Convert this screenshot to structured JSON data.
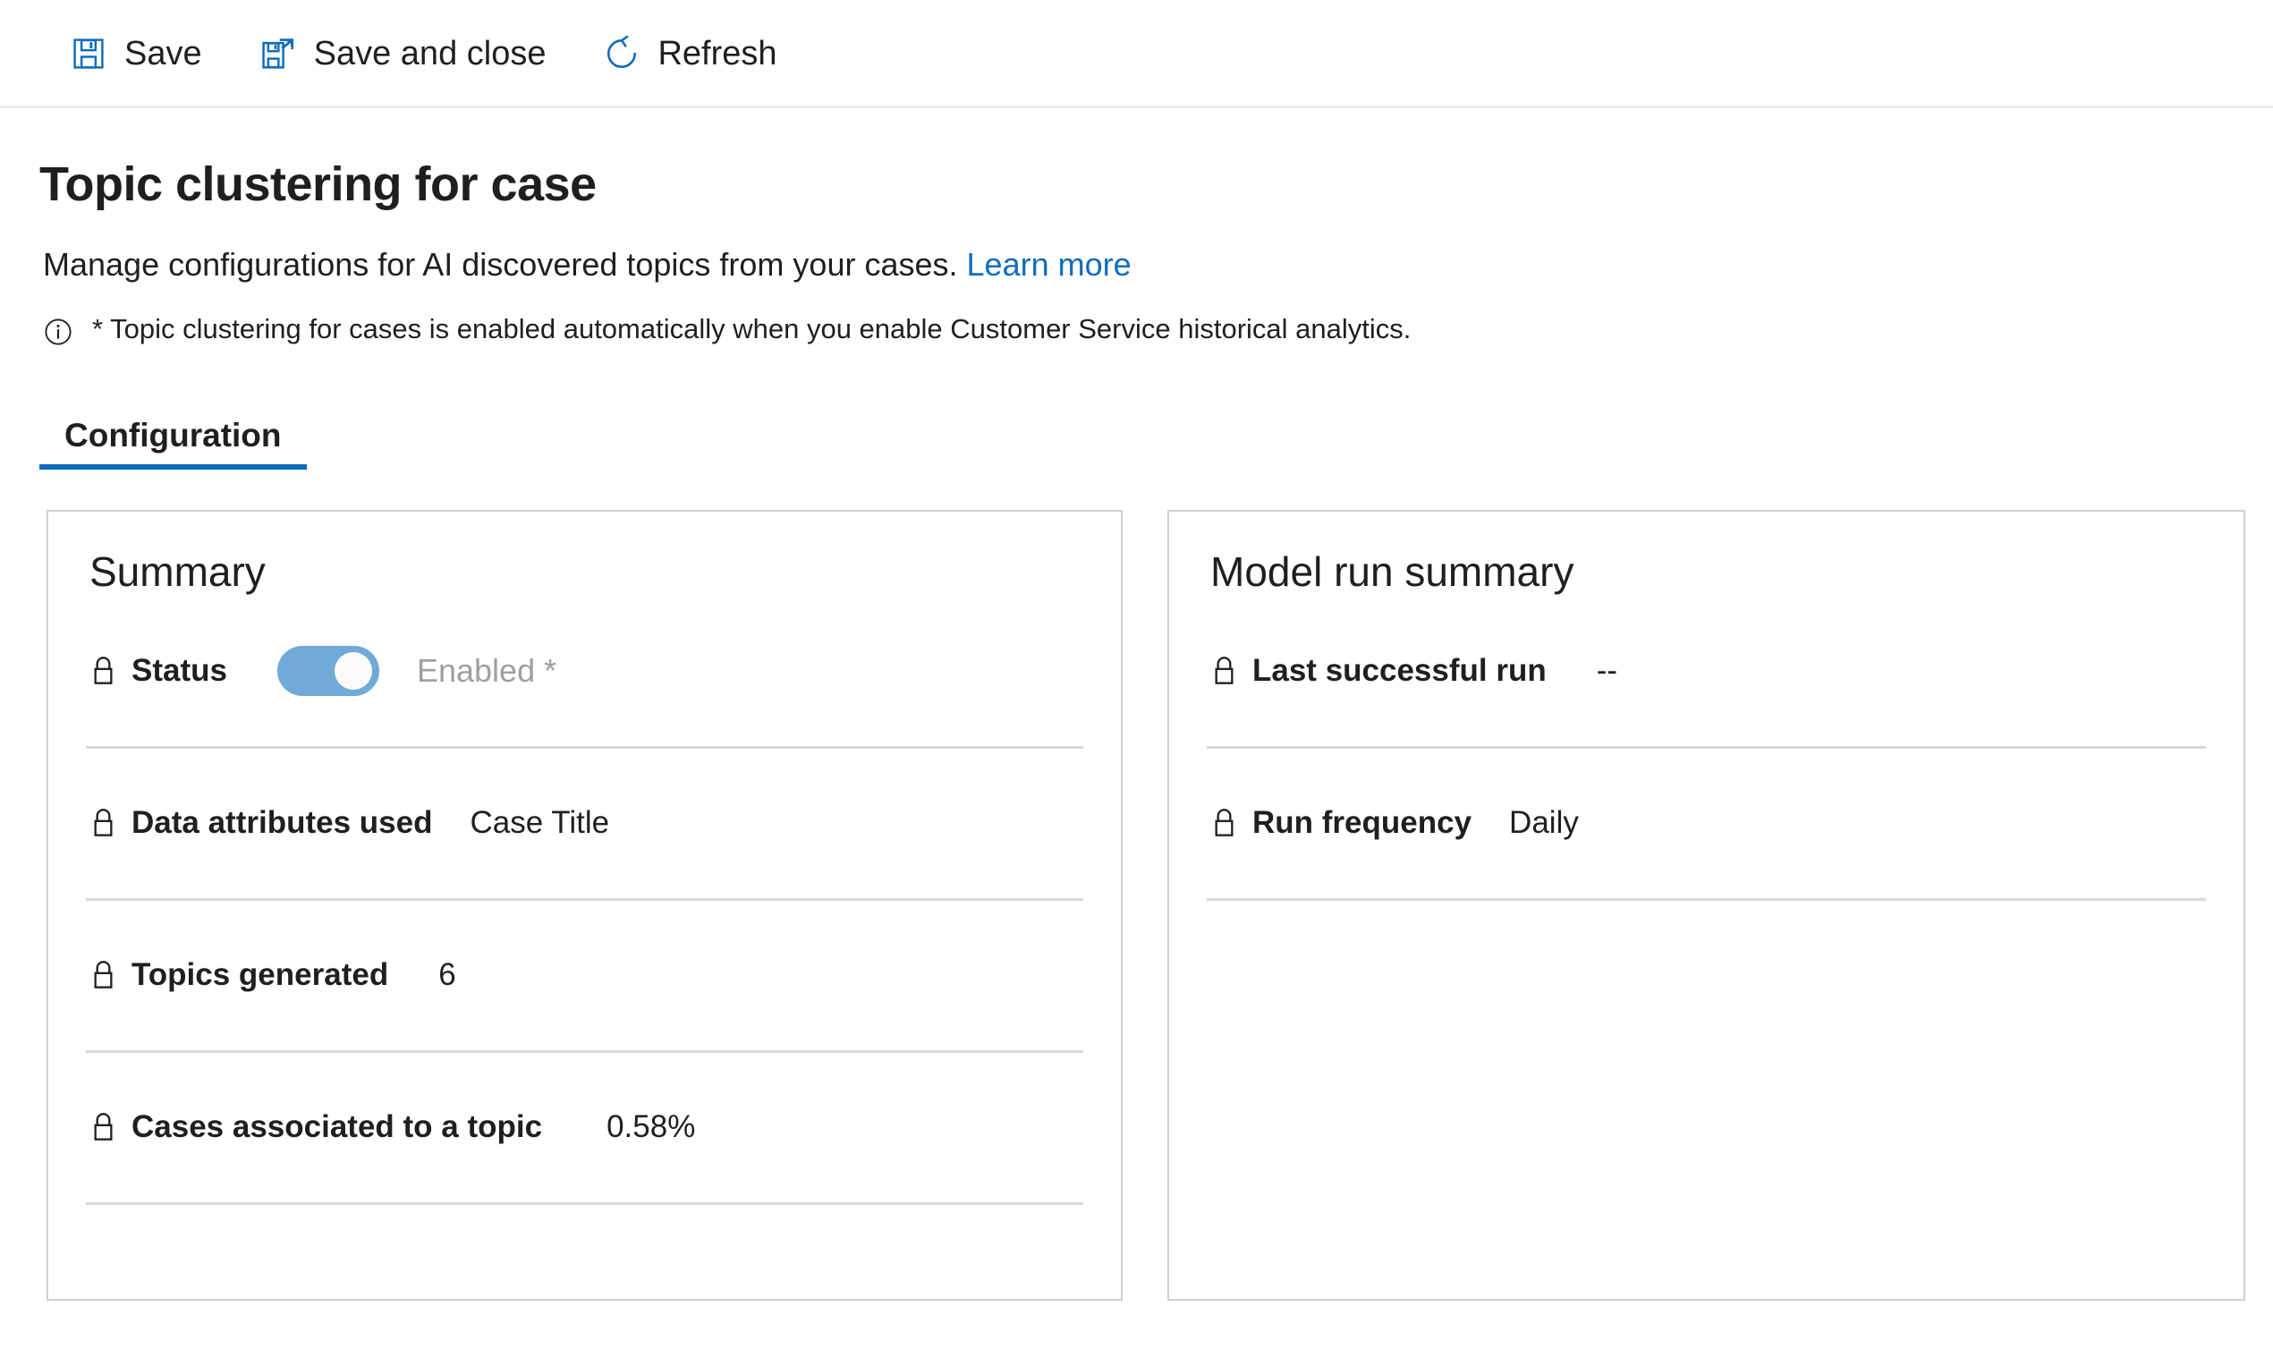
{
  "commandbar": {
    "buttons": [
      {
        "label": "Save",
        "icon": "save-icon"
      },
      {
        "label": "Save and close",
        "icon": "save-and-close-icon"
      },
      {
        "label": "Refresh",
        "icon": "refresh-icon"
      }
    ]
  },
  "page": {
    "title": "Topic clustering for case",
    "subtitle_text": "Manage configurations for AI discovered topics from your cases.",
    "learn_more": "Learn more",
    "note_icon": "info-icon",
    "note": "* Topic clustering for cases is enabled automatically when you enable Customer Service historical analytics."
  },
  "tabs": [
    {
      "label": "Configuration",
      "active": true
    }
  ],
  "summary_card": {
    "title": "Summary",
    "status": {
      "label": "Status",
      "toggle_on": true,
      "toggle_text": "Enabled *",
      "lock_icon": "lock-icon"
    },
    "fields": [
      {
        "label": "Data attributes used",
        "value": "Case Title",
        "lock_icon": "lock-icon"
      },
      {
        "label": "Topics generated",
        "value": "6",
        "lock_icon": "lock-icon"
      },
      {
        "label": "Cases associated to a topic",
        "value": "0.58%",
        "lock_icon": "lock-icon"
      }
    ]
  },
  "model_run_card": {
    "title": "Model run summary",
    "fields": [
      {
        "label": "Last successful run",
        "value": "--",
        "lock_icon": "lock-icon"
      },
      {
        "label": "Run frequency",
        "value": "Daily",
        "lock_icon": "lock-icon"
      }
    ]
  },
  "colors": {
    "accent": "#0f6cbd",
    "toggle_on": "#71a9d8",
    "toggle_text": "#a19f9d",
    "card_border": "#d2d0ce",
    "divider": "#d9d8d6"
  }
}
